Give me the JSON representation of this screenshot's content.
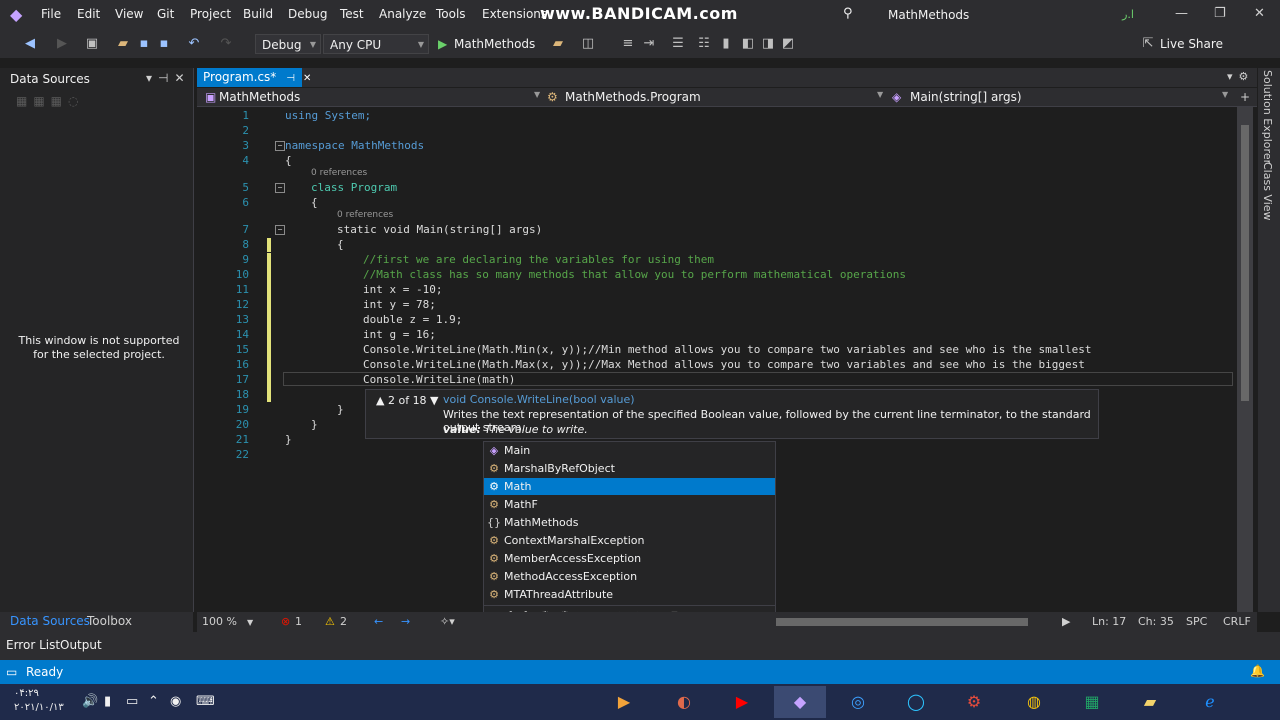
{
  "menubar": {
    "items": [
      "File",
      "Edit",
      "View",
      "Git",
      "Project",
      "Build",
      "Debug",
      "Test",
      "Analyze",
      "Tools",
      "Extensions"
    ],
    "watermark": "www.BANDICAM.com",
    "title": "MathMethods",
    "avatar": "ا.ر"
  },
  "toolbar": {
    "config": "Debug",
    "platform": "Any CPU",
    "run_target": "MathMethods",
    "live_share": "Live Share"
  },
  "data_sources": {
    "title": "Data Sources",
    "message": "This window is not supported for the selected project."
  },
  "left_tabs": [
    "Data Sources",
    "Toolbox"
  ],
  "editor": {
    "tab_label": "Program.cs*",
    "nav": [
      "MathMethods",
      "MathMethods.Program",
      "Main(string[] args)"
    ],
    "line_numbers": [
      "1",
      "2",
      "3",
      "4",
      "5",
      "6",
      "7",
      "8",
      "9",
      "10",
      "11",
      "12",
      "13",
      "14",
      "15",
      "16",
      "17",
      "18",
      "19",
      "20",
      "21",
      "22"
    ],
    "references": "0 references",
    "lines": {
      "l1": "using System;",
      "l3": "namespace MathMethods",
      "l4": "{",
      "l5": "class Program",
      "l6": "{",
      "l7": "static void Main(string[] args)",
      "l8": "{",
      "l9": "//first we are declaring the variables for using them",
      "l10": "//Math class has so many methods that allow you to perform mathematical operations",
      "l11": "int x = -10;",
      "l12": "int y = 78;",
      "l13": "double z = 1.9;",
      "l14": "int g = 16;",
      "l15": "Console.WriteLine(Math.Min(x, y));//Min method allows you to compare two variables and see who is the smallest",
      "l16": "Console.WriteLine(Math.Max(x, y));//Max Method allows you to compare two variables and see who is the biggest",
      "l17": "Console.WriteLine(math)",
      "l19": "}",
      "l20": "}",
      "l21": "}"
    }
  },
  "tooltip": {
    "overload": "2 of 18",
    "signature": "void Console.WriteLine(bool value)",
    "description": "Writes the text representation of the specified Boolean value, followed by the current line terminator, to the standard output stream.",
    "param_name": "value:",
    "param_desc": "The value to write."
  },
  "completion": {
    "items": [
      "Main",
      "MarshalByRefObject",
      "Math",
      "MathF",
      "MathMethods",
      "ContextMarshalException",
      "MemberAccessException",
      "MethodAccessException",
      "MTAThreadAttribute"
    ],
    "selected": "Math"
  },
  "editor_status": {
    "zoom": "100 %",
    "errors": "1",
    "warnings": "2",
    "line": "Ln: 17",
    "col": "Ch: 35",
    "spc": "SPC",
    "eol": "CRLF"
  },
  "bottom_tabs": [
    "Error List",
    "Output"
  ],
  "statusbar": {
    "text": "Ready"
  },
  "side_tabs": [
    "Solution Explorer",
    "Class View"
  ],
  "taskbar": {
    "time": "۰۴:۲۹",
    "date": "۲۰۲۱/۱۰/۱۳"
  },
  "colors": {
    "accent": "#007acc",
    "background": "#1e1e1e",
    "chrome": "#2d2d30"
  }
}
